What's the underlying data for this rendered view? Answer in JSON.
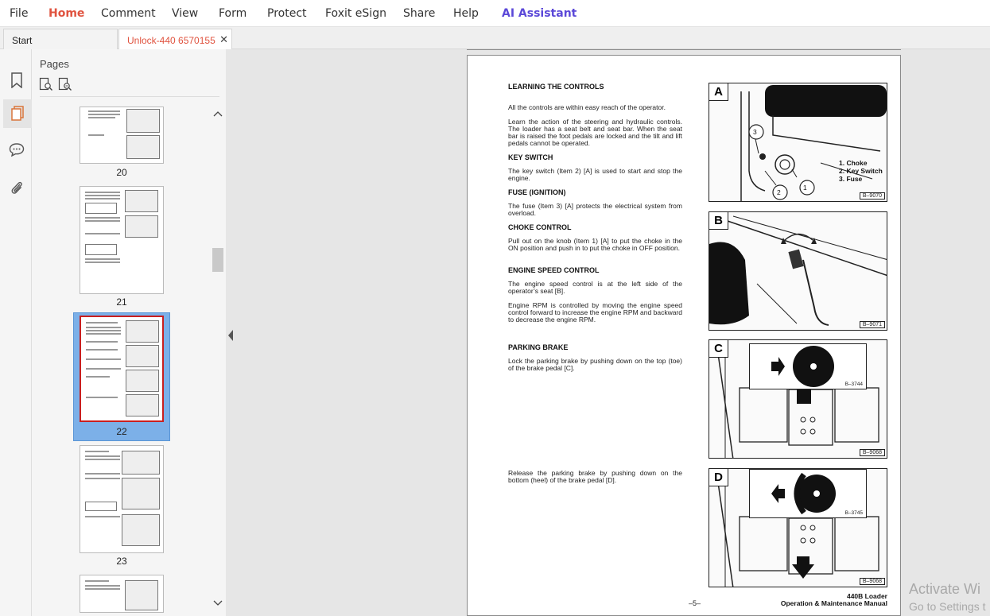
{
  "menu": {
    "items": [
      "File",
      "Home",
      "Comment",
      "View",
      "Form",
      "Protect",
      "Foxit eSign",
      "Share",
      "Help",
      "AI Assistant"
    ],
    "active": "Home"
  },
  "tabs": [
    {
      "label": "Start",
      "active": false
    },
    {
      "label": "Unlock-440 6570155 ...",
      "active": true
    }
  ],
  "sidebar": {
    "icons": [
      "bookmark-icon",
      "pages-icon",
      "comment-icon",
      "attachment-icon"
    ],
    "active": "pages-icon"
  },
  "pages_panel": {
    "title": "Pages",
    "tools": [
      "insert-page-icon",
      "page-options-icon"
    ],
    "thumbnails": [
      {
        "number": "20",
        "selected": false
      },
      {
        "number": "21",
        "selected": false
      },
      {
        "number": "22",
        "selected": true
      },
      {
        "number": "23",
        "selected": false
      }
    ]
  },
  "document": {
    "heading_learning": "LEARNING THE CONTROLS",
    "para_reach": "All the controls are within easy reach of the operator.",
    "para_learn": "Learn the action of the steering and hydraulic controls. The loader has a seat belt and seat bar. When the seat bar is raised the foot pedals are locked and the tilt and lift pedals cannot be operated.",
    "heading_key": "KEY SWITCH",
    "para_key": "The key switch (Item 2) [A] is used to start and stop the engine.",
    "heading_fuse": "FUSE (IGNITION)",
    "para_fuse": "The fuse (Item 3) [A] protects the electrical system from overload.",
    "heading_choke": "CHOKE CONTROL",
    "para_choke": "Pull out on the knob (Item 1) [A] to put the choke in the ON position and push in to put the choke in OFF position.",
    "heading_speed": "ENGINE SPEED CONTROL",
    "para_speed1": "The engine speed control is at the left side of the operator’s seat [B].",
    "para_speed2": "Engine RPM is controlled by moving the engine speed control forward to increase the engine RPM and backward to decrease the engine RPM.",
    "heading_brake": "PARKING BRAKE",
    "para_brake_lock": "Lock the parking brake by pushing down on the top (toe) of the brake pedal [C].",
    "para_brake_release": "Release the parking brake by pushing down on the bottom (heel) of the brake pedal [D].",
    "figures": [
      {
        "letter": "A",
        "code": "B–9070",
        "legend": [
          "1. Choke",
          "2. Key Switch",
          "3. Fuse"
        ]
      },
      {
        "letter": "B",
        "code": "B–9071"
      },
      {
        "letter": "C",
        "code": "B–9068",
        "inset_code": "B–3744"
      },
      {
        "letter": "D",
        "code": "B–9068",
        "inset_code": "B–3745"
      }
    ],
    "callouts": [
      "1",
      "2",
      "3"
    ],
    "page_number": "–5–",
    "footer_line1": "440B Loader",
    "footer_line2": "Operation & Maintenance Manual"
  },
  "watermark": {
    "line1": "Activate Wi",
    "line2": "Go to Settings t"
  }
}
